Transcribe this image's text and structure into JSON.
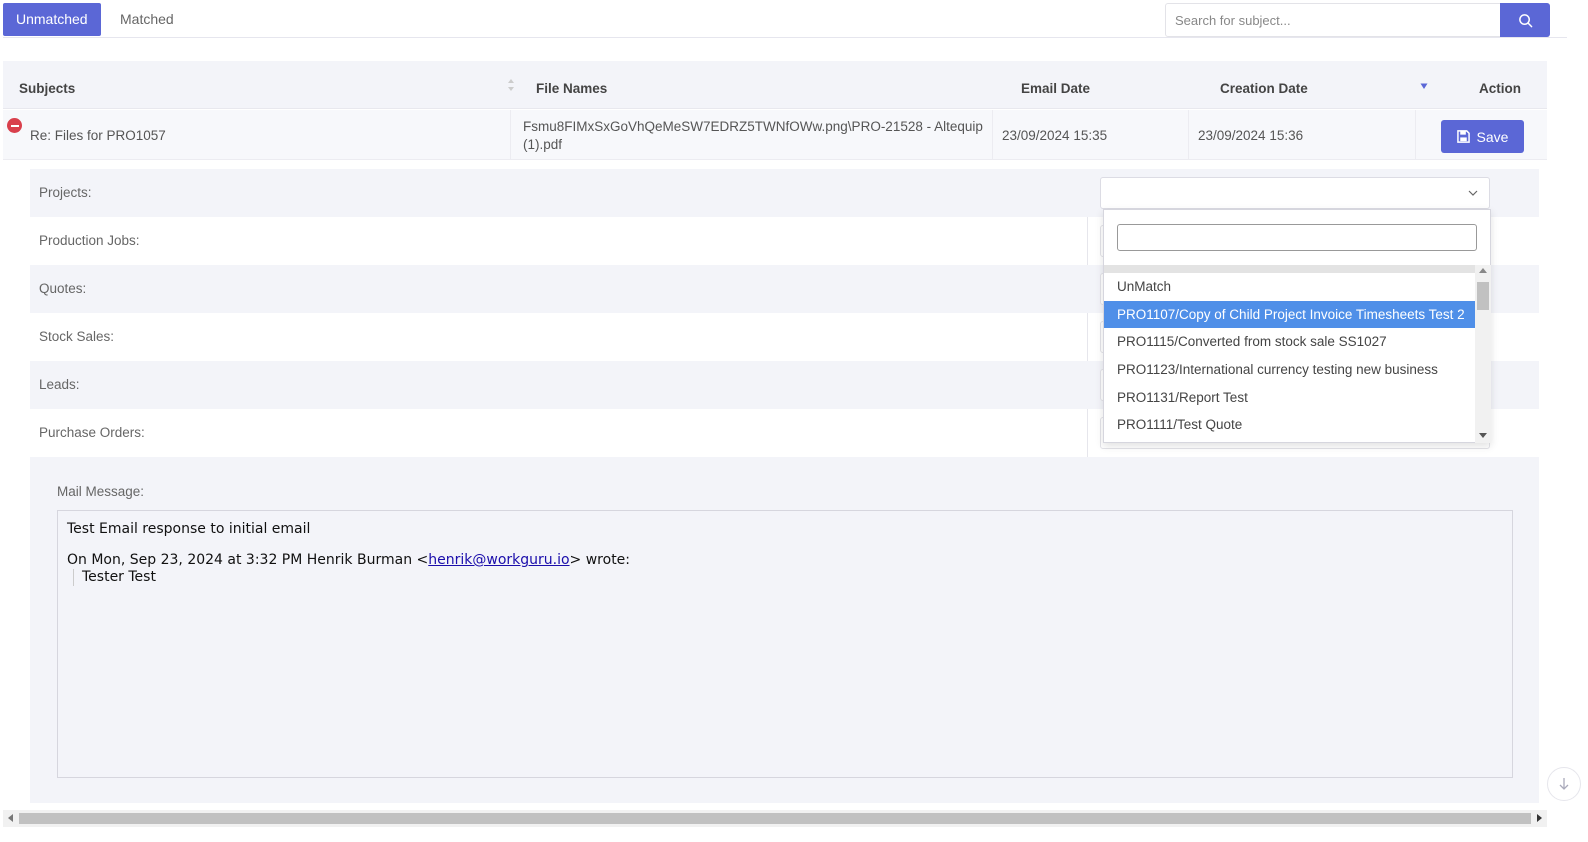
{
  "tabs": {
    "unmatched_label": "Unmatched",
    "matched_label": "Matched"
  },
  "search": {
    "placeholder": "Search for subject...",
    "icon": "search-icon"
  },
  "table": {
    "columns": {
      "subjects": "Subjects",
      "file_names": "File Names",
      "email_date": "Email Date",
      "creation_date": "Creation Date",
      "action": "Action"
    },
    "row": {
      "subject": "Re: Files for PRO1057",
      "file_name_line1": "Fsmu8FIMxSxGoVhQeMeSW7EDRZ5TWNfOWw.png\\PRO-21528 - Altequip",
      "file_name_line2": "(1).pdf",
      "email_date": "23/09/2024 15:35",
      "creation_date": "23/09/2024 15:36",
      "save_label": "Save"
    }
  },
  "detail": {
    "fields": {
      "projects": "Projects:",
      "production_jobs": "Production Jobs:",
      "quotes": "Quotes:",
      "stock_sales": "Stock Sales:",
      "leads": "Leads:",
      "purchase_orders": "Purchase Orders:"
    },
    "mail_label": "Mail Message:",
    "mail": {
      "line1": "Test Email response to initial email",
      "line2_prefix": "On Mon, Sep 23, 2024 at 3:32 PM Henrik Burman <",
      "line2_link": "henrik@workguru.io",
      "line2_suffix": "> wrote:",
      "quote": "Tester Test"
    }
  },
  "dropdown": {
    "search_value": "",
    "options": [
      "UnMatch",
      "PRO1107/Copy of Child Project Invoice Timesheets Test 2",
      "PRO1115/Converted from stock sale SS1027",
      "PRO1123/International currency testing new business",
      "PRO1131/Report Test",
      "PRO1111/Test Quote"
    ],
    "selected_index": 1
  },
  "colors": {
    "accent": "#5b67d6",
    "selected_option": "#4f8fe8",
    "remove": "#d9404c"
  }
}
